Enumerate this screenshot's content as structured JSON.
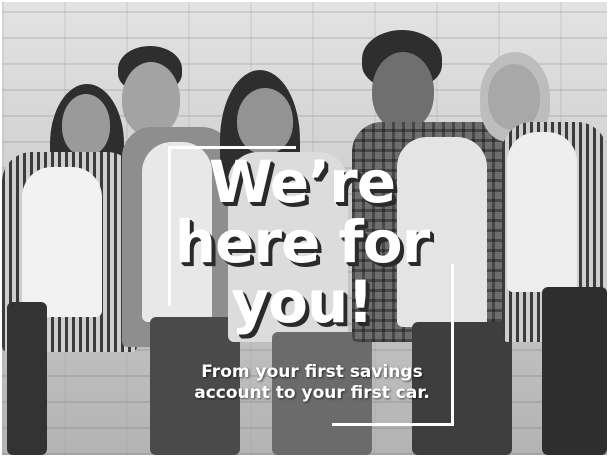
{
  "ad": {
    "headline_lines": [
      "We’re",
      "here for",
      "you!"
    ],
    "subtext_lines": [
      "From your first savings",
      "account to your first car."
    ]
  },
  "colors": {
    "text": "#ffffff",
    "shadow": "#2a2a2a",
    "frame": "#ffffff"
  }
}
